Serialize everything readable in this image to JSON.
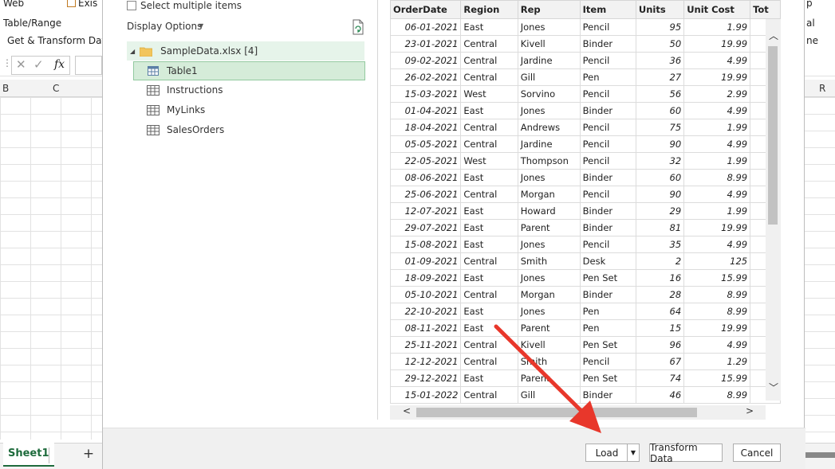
{
  "excel": {
    "ribbon": {
      "web": "Web",
      "existing": "Exis",
      "table_range": "Table/Range",
      "get_transform": "Get & Transform Data",
      "right_top": "p",
      "right_mid": "al",
      "right_bot": "ne"
    },
    "formula": {
      "fx": "fx"
    },
    "columns": [
      "B",
      "C",
      "R"
    ],
    "sheet_tab": "Sheet1",
    "add_sheet": "+"
  },
  "navigator": {
    "select_multiple": "Select multiple items",
    "display_options": "Display Options",
    "tree": {
      "folder": "SampleData.xlsx [4]",
      "items": [
        "Table1",
        "Instructions",
        "MyLinks",
        "SalesOrders"
      ]
    },
    "buttons": {
      "load": "Load",
      "transform": "Transform Data",
      "cancel": "Cancel"
    },
    "table": {
      "headers": [
        "OrderDate",
        "Region",
        "Rep",
        "Item",
        "Units",
        "Unit Cost",
        "Tot"
      ],
      "rows": [
        [
          "06-01-2021",
          "East",
          "Jones",
          "Pencil",
          "95",
          "1.99"
        ],
        [
          "23-01-2021",
          "Central",
          "Kivell",
          "Binder",
          "50",
          "19.99"
        ],
        [
          "09-02-2021",
          "Central",
          "Jardine",
          "Pencil",
          "36",
          "4.99"
        ],
        [
          "26-02-2021",
          "Central",
          "Gill",
          "Pen",
          "27",
          "19.99"
        ],
        [
          "15-03-2021",
          "West",
          "Sorvino",
          "Pencil",
          "56",
          "2.99"
        ],
        [
          "01-04-2021",
          "East",
          "Jones",
          "Binder",
          "60",
          "4.99"
        ],
        [
          "18-04-2021",
          "Central",
          "Andrews",
          "Pencil",
          "75",
          "1.99"
        ],
        [
          "05-05-2021",
          "Central",
          "Jardine",
          "Pencil",
          "90",
          "4.99"
        ],
        [
          "22-05-2021",
          "West",
          "Thompson",
          "Pencil",
          "32",
          "1.99"
        ],
        [
          "08-06-2021",
          "East",
          "Jones",
          "Binder",
          "60",
          "8.99"
        ],
        [
          "25-06-2021",
          "Central",
          "Morgan",
          "Pencil",
          "90",
          "4.99"
        ],
        [
          "12-07-2021",
          "East",
          "Howard",
          "Binder",
          "29",
          "1.99"
        ],
        [
          "29-07-2021",
          "East",
          "Parent",
          "Binder",
          "81",
          "19.99"
        ],
        [
          "15-08-2021",
          "East",
          "Jones",
          "Pencil",
          "35",
          "4.99"
        ],
        [
          "01-09-2021",
          "Central",
          "Smith",
          "Desk",
          "2",
          "125"
        ],
        [
          "18-09-2021",
          "East",
          "Jones",
          "Pen Set",
          "16",
          "15.99"
        ],
        [
          "05-10-2021",
          "Central",
          "Morgan",
          "Binder",
          "28",
          "8.99"
        ],
        [
          "22-10-2021",
          "East",
          "Jones",
          "Pen",
          "64",
          "8.99"
        ],
        [
          "08-11-2021",
          "East",
          "Parent",
          "Pen",
          "15",
          "19.99"
        ],
        [
          "25-11-2021",
          "Central",
          "Kivell",
          "Pen Set",
          "96",
          "4.99"
        ],
        [
          "12-12-2021",
          "Central",
          "Smith",
          "Pencil",
          "67",
          "1.29"
        ],
        [
          "29-12-2021",
          "East",
          "Parent",
          "Pen Set",
          "74",
          "15.99"
        ],
        [
          "15-01-2022",
          "Central",
          "Gill",
          "Binder",
          "46",
          "8.99"
        ]
      ]
    }
  },
  "colors": {
    "accent_green": "#1e6b3c",
    "selection_bg": "#d5ecd9",
    "annotation_red": "#e8372b"
  },
  "icons": [
    "folder-icon",
    "table-icon",
    "refresh-icon",
    "caret-down-icon",
    "scroll-up-icon",
    "scroll-down-icon",
    "scroll-left-icon",
    "scroll-right-icon",
    "red-arrow-annotation"
  ]
}
